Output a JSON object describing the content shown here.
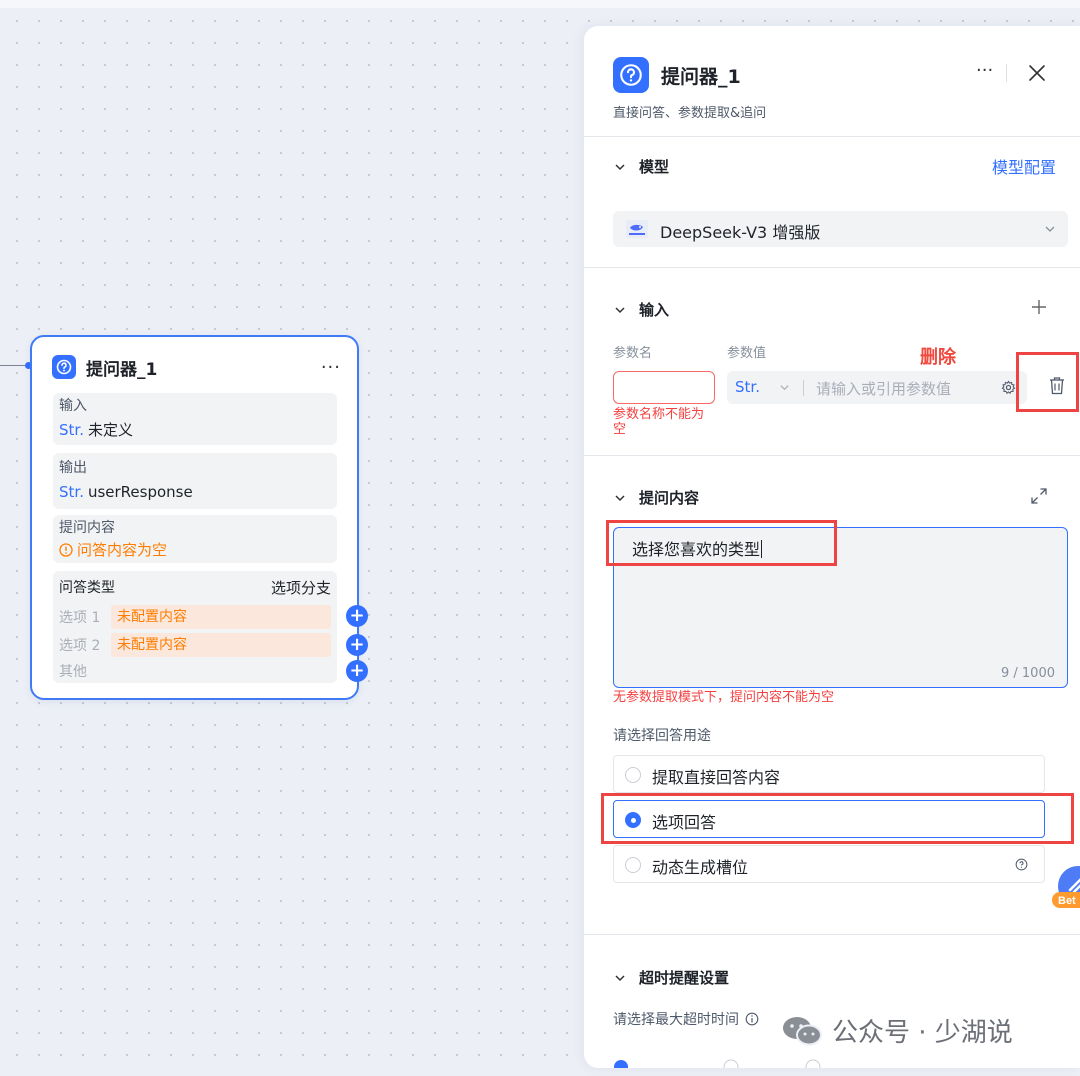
{
  "node": {
    "title": "提问器_1",
    "more": "···",
    "input": {
      "label": "输入",
      "type": "Str.",
      "value": "未定义"
    },
    "output": {
      "label": "输出",
      "type": "Str.",
      "value": "userResponse"
    },
    "question": {
      "label": "提问内容",
      "warning": "问答内容为空"
    },
    "answer_type": {
      "label": "问答类型",
      "value": "选项分支",
      "options": [
        {
          "label": "选项 1",
          "content": "未配置内容"
        },
        {
          "label": "选项 2",
          "content": "未配置内容"
        }
      ],
      "other": "其他"
    }
  },
  "panel": {
    "title": "提问器_1",
    "subtitle": "直接问答、参数提取&追问",
    "more": "···",
    "model": {
      "section": "模型",
      "config_link": "模型配置",
      "selected": "DeepSeek-V3 增强版"
    },
    "input": {
      "section": "输入",
      "param_name_col": "参数名",
      "param_value_col": "参数值",
      "delete_note": "删除",
      "type": "Str.",
      "value_placeholder": "请输入或引用参数值",
      "name_error_line1": "参数名称不能为",
      "name_error_line2": "空"
    },
    "question": {
      "section": "提问内容",
      "text": "选择您喜欢的类型",
      "count": "9 / 1000",
      "error": "无参数提取模式下，提问内容不能为空"
    },
    "answer_use": {
      "label": "请选择回答用途",
      "options": [
        {
          "text": "提取直接回答内容",
          "selected": false
        },
        {
          "text": "选项回答",
          "selected": true
        },
        {
          "text": "动态生成槽位",
          "selected": false
        }
      ]
    },
    "timeout": {
      "section": "超时提醒设置",
      "label": "请选择最大超时时间"
    }
  },
  "watermark": "公众号 · 少湖说",
  "colors": {
    "accent": "#3370ff",
    "warning": "#ff7d00",
    "error": "#f53f3f",
    "annotation": "#ef4444"
  }
}
